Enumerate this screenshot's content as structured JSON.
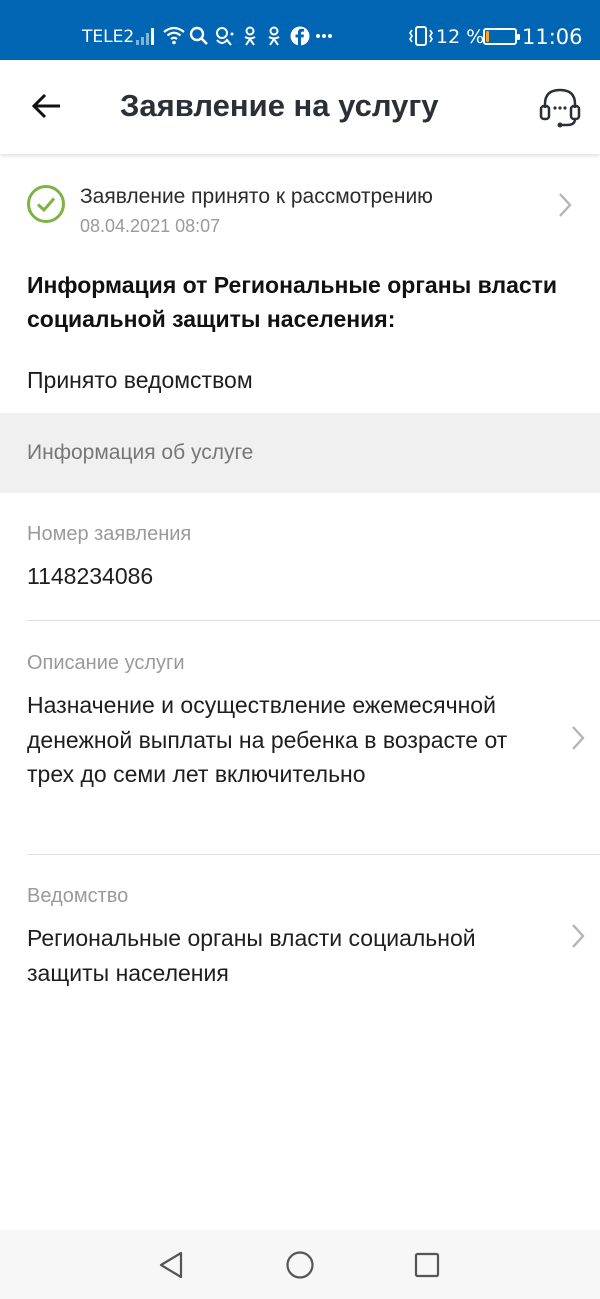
{
  "status_bar": {
    "carrier": "TELE2",
    "battery_percent": "12 %",
    "battery_level": 0.12,
    "battery_color": "#f5a623",
    "time": "11:06",
    "icons": [
      "signal-icon",
      "wifi-icon",
      "search-icon",
      "app-icon",
      "odnoklassniki-icon",
      "odnoklassniki-icon",
      "facebook-icon",
      "more-icon",
      "vibrate-icon"
    ]
  },
  "app_bar": {
    "title": "Заявление на услугу",
    "back_icon": "arrow-left-icon",
    "support_icon": "headset-icon"
  },
  "status": {
    "text": "Заявление принято к рассмотрению",
    "date": "08.04.2021 08:07",
    "icon": "check-circle-icon",
    "icon_color": "#7cb342"
  },
  "info": {
    "heading": "Информация от Региональные органы власти социальной защиты населения:",
    "accepted_text": "Принято ведомством"
  },
  "section": {
    "title": "Информация об услуге"
  },
  "fields": {
    "number": {
      "label": "Номер заявления",
      "value": "1148234086"
    },
    "description": {
      "label": "Описание услуги",
      "value": "Назначение и осуществление ежемесячной денежной выплаты на ребенка в возрасте от трех до семи лет включительно"
    },
    "department": {
      "label": "Ведомство",
      "value": "Региональные органы власти социальной защиты населения"
    }
  },
  "nav_bar": {
    "back": "nav-back-icon",
    "home": "nav-home-icon",
    "recents": "nav-recents-icon"
  },
  "colors": {
    "status_bar": "#0066b3",
    "title": "#2b2f38",
    "muted": "#9a9a9a"
  }
}
